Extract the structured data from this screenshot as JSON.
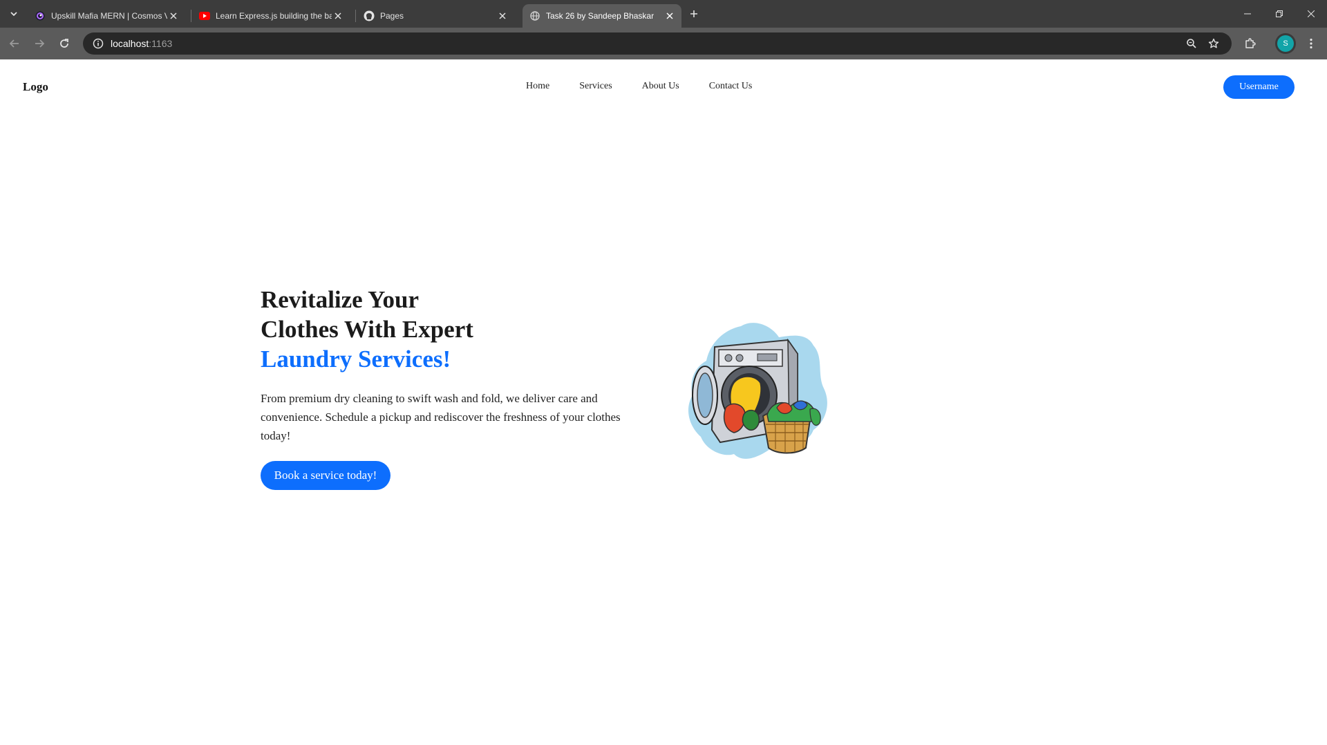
{
  "browser": {
    "tabs": [
      {
        "title": "Upskill Mafia MERN | Cosmos V",
        "favicon": "cosmos-icon"
      },
      {
        "title": "Learn Express.js building the ba",
        "favicon": "youtube-icon"
      },
      {
        "title": "Pages",
        "favicon": "github-icon"
      },
      {
        "title": "Task 26 by Sandeep Bhaskar",
        "favicon": "globe-icon",
        "active": true
      }
    ],
    "url_host": "localhost",
    "url_port": ":1163",
    "profile_initial": "S",
    "profile_color": "#12a4a8"
  },
  "site": {
    "logo": "Logo",
    "nav": [
      "Home",
      "Services",
      "About Us",
      "Contact Us"
    ],
    "username_button": "Username",
    "accent_color": "#0d6efd",
    "hero": {
      "title_line1": "Revitalize Your",
      "title_line2": "Clothes With Expert",
      "title_accent": "Laundry Services!",
      "description": "From premium dry cleaning to swift wash and fold, we deliver care and convenience. Schedule a pickup and rediscover the freshness of your clothes today!",
      "cta": "Book a service today!",
      "image": "washing-machine-laundry-basket-illustration"
    }
  }
}
